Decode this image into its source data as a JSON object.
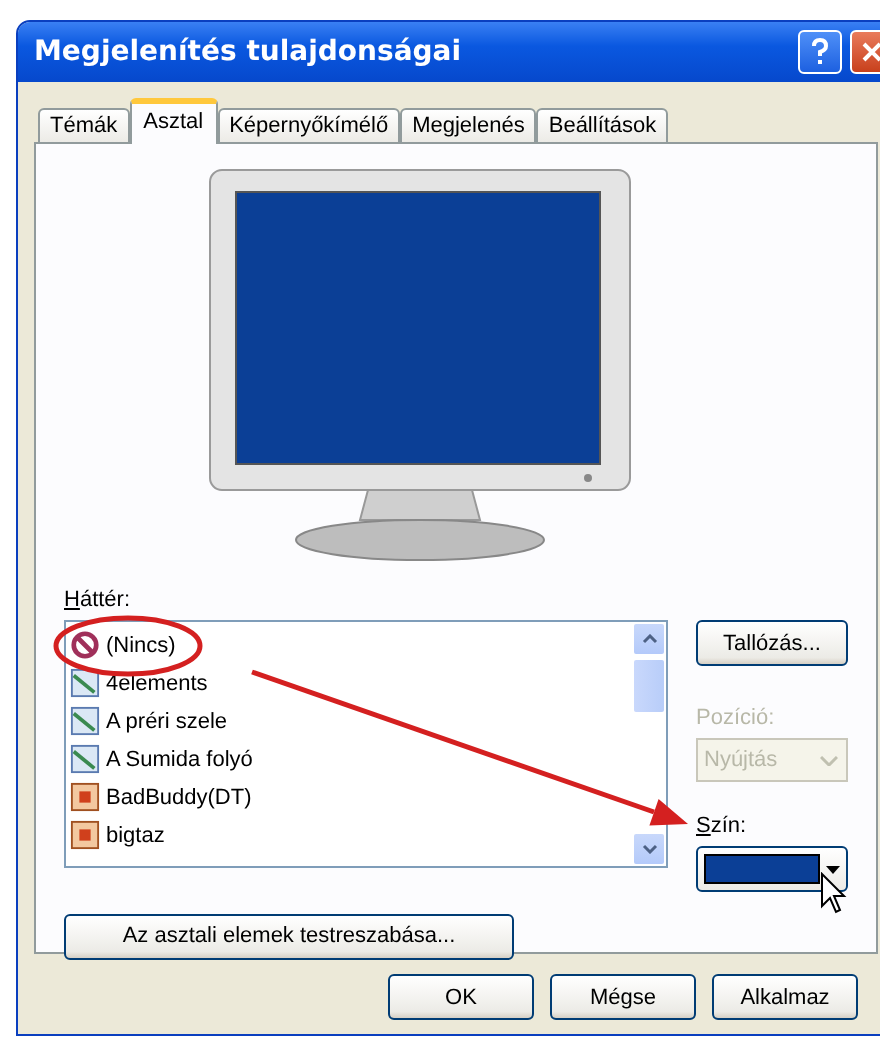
{
  "window": {
    "title": "Megjelenítés tulajdonságai"
  },
  "tabs": [
    {
      "label": "Témák",
      "selected": false
    },
    {
      "label": "Asztal",
      "selected": true
    },
    {
      "label": "Képernyőkímélő",
      "selected": false
    },
    {
      "label": "Megjelenés",
      "selected": false
    },
    {
      "label": "Beállítások",
      "selected": false
    }
  ],
  "background": {
    "label": "Háttér:",
    "items": [
      {
        "label": "(Nincs)",
        "kind": "none"
      },
      {
        "label": "4elements",
        "kind": "picture"
      },
      {
        "label": "A préri szele",
        "kind": "picture"
      },
      {
        "label": "A Sumida folyó",
        "kind": "picture"
      },
      {
        "label": "BadBuddy(DT)",
        "kind": "html"
      },
      {
        "label": "bigtaz",
        "kind": "html"
      }
    ]
  },
  "browse_button": "Tallózás...",
  "position": {
    "label": "Pozíció:",
    "value": "Nyújtás",
    "disabled": true
  },
  "color_picker": {
    "label": "Szín:",
    "color": "#0b3f96"
  },
  "customize_button": "Az asztali elemek testreszabása...",
  "buttons": [
    "OK",
    "Mégse",
    "Alkalmaz"
  ]
}
